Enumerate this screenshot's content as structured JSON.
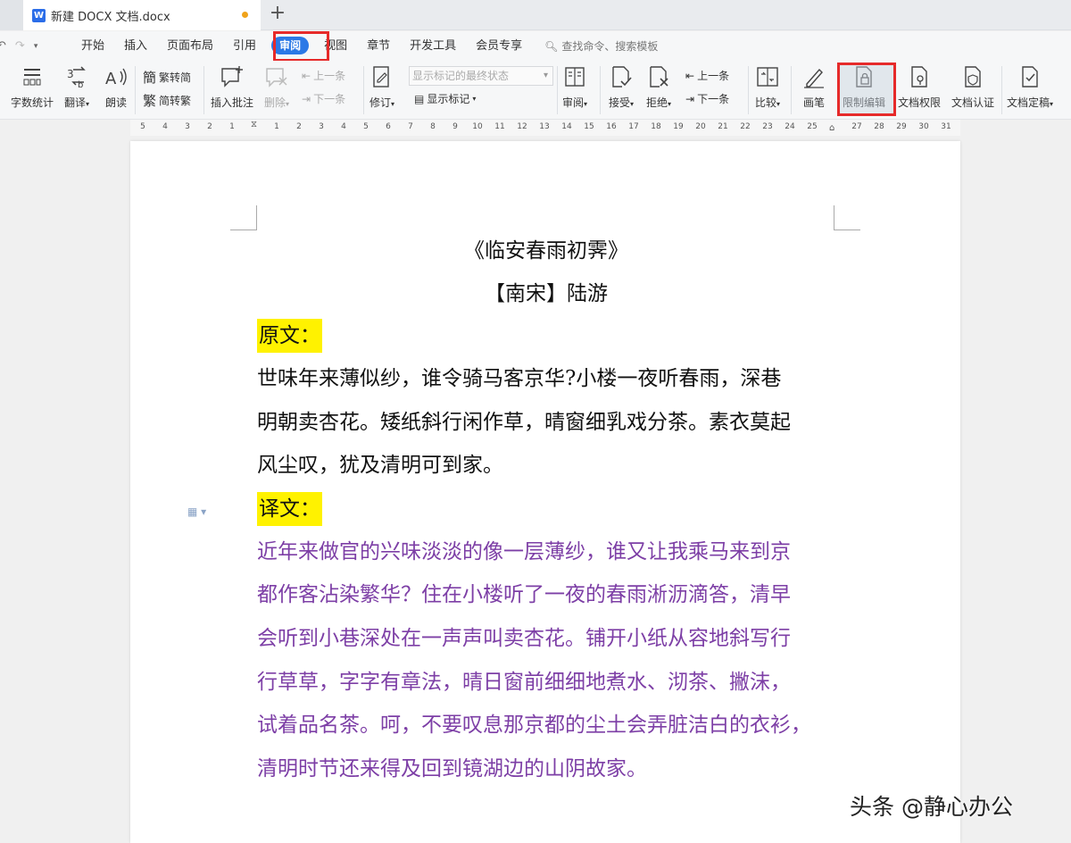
{
  "titlebar": {
    "doc_tab_icon": "W",
    "doc_tab_name": "新建 DOCX 文档.docx",
    "new_tab": "+"
  },
  "menubar": {
    "items": [
      "开始",
      "插入",
      "页面布局",
      "引用",
      "审阅",
      "视图",
      "章节",
      "开发工具",
      "会员专享"
    ],
    "active": "审阅",
    "search_placeholder": "查找命令、搜索模板"
  },
  "ribbon": {
    "word_count": "字数统计",
    "translate": "翻译",
    "read_aloud": "朗读",
    "trad_to_simp": "繁转简",
    "simp_to_trad": "简转繁",
    "insert_comment": "插入批注",
    "delete": "删除",
    "prev_comment": "上一条",
    "next_comment": "下一条",
    "track_changes": "修订",
    "markup_state": "显示标记的最终状态",
    "show_markup": "显示标记",
    "review_pane": "审阅",
    "accept": "接受",
    "reject": "拒绝",
    "prev_change": "上一条",
    "next_change": "下一条",
    "compare": "比较",
    "pen": "画笔",
    "restrict_editing": "限制编辑",
    "doc_permissions": "文档权限",
    "doc_certification": "文档认证",
    "doc_finalize": "文档定稿"
  },
  "ruler": {
    "left_numbers": [
      "5",
      "4",
      "3",
      "2",
      "1"
    ],
    "right_numbers": [
      "1",
      "2",
      "3",
      "4",
      "5",
      "6",
      "7",
      "8",
      "9",
      "10",
      "11",
      "12",
      "13",
      "14",
      "15",
      "16",
      "17",
      "18",
      "19",
      "20",
      "21",
      "22",
      "23",
      "24",
      "25",
      "27",
      "28",
      "29",
      "30",
      "31"
    ]
  },
  "document": {
    "title": "《临安春雨初霁》",
    "author": "【南宋】陆游",
    "original_label": "原文：",
    "original_lines": [
      "世味年来薄似纱，谁令骑马客京华?小楼一夜听春雨，深巷",
      "明朝卖杏花。矮纸斜行闲作草，晴窗细乳戏分茶。素衣莫起",
      "风尘叹，犹及清明可到家。"
    ],
    "translation_label": "译文：",
    "translation_lines": [
      "近年来做官的兴味淡淡的像一层薄纱，谁又让我乘马来到京",
      "都作客沾染繁华？住在小楼听了一夜的春雨淅沥滴答，清早",
      "会听到小巷深处在一声声叫卖杏花。铺开小纸从容地斜写行",
      "行草草，字字有章法，晴日窗前细细地煮水、沏茶、撇沫，",
      "试着品名茶。呵，不要叹息那京都的尘土会弄脏洁白的衣衫，",
      "清明时节还来得及回到镜湖边的山阴故家。"
    ]
  },
  "watermark": "头条 @静心办公",
  "colors": {
    "accent": "#2b79e6",
    "highlight_box": "#e62a2a",
    "text_highlight": "#fff200",
    "translation_text": "#7d3fa6"
  }
}
